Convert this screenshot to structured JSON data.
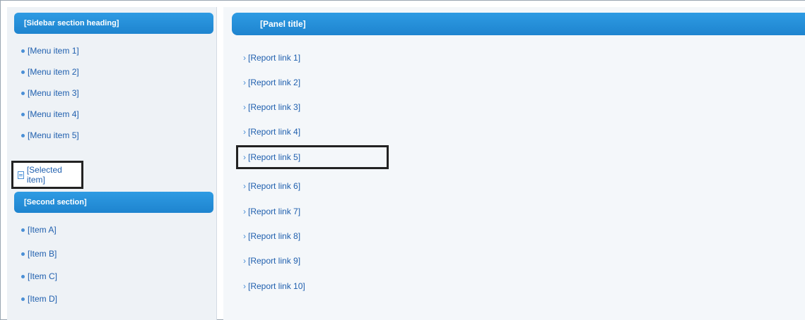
{
  "sidebar": {
    "header": "[Sidebar section heading]",
    "items": [
      {
        "label": "[Menu item 1]"
      },
      {
        "label": "[Menu item 2]"
      },
      {
        "label": "[Menu item 3]"
      },
      {
        "label": "[Menu item 4]"
      },
      {
        "label": "[Menu item 5]"
      }
    ],
    "active_item": {
      "label": "[Selected item]",
      "icon": "document-icon"
    },
    "section2_header": "[Second section]",
    "section2_items": [
      {
        "label": "[Item A]"
      },
      {
        "label": "[Item B]"
      },
      {
        "label": "[Item C]"
      },
      {
        "label": "[Item D]"
      }
    ]
  },
  "main": {
    "header": "[Panel title]",
    "links": [
      {
        "label": "[Report link 1]"
      },
      {
        "label": "[Report link 2]"
      },
      {
        "label": "[Report link 3]"
      },
      {
        "label": "[Report link 4]"
      },
      {
        "label": "[Report link 5]"
      },
      {
        "label": "[Report link 6]"
      },
      {
        "label": "[Report link 7]"
      },
      {
        "label": "[Report link 8]"
      },
      {
        "label": "[Report link 9]"
      },
      {
        "label": "[Report link 10]"
      }
    ]
  },
  "colors": {
    "accent": "#1e84cf",
    "link": "#1f5fae",
    "highlight_border": "#222222"
  }
}
